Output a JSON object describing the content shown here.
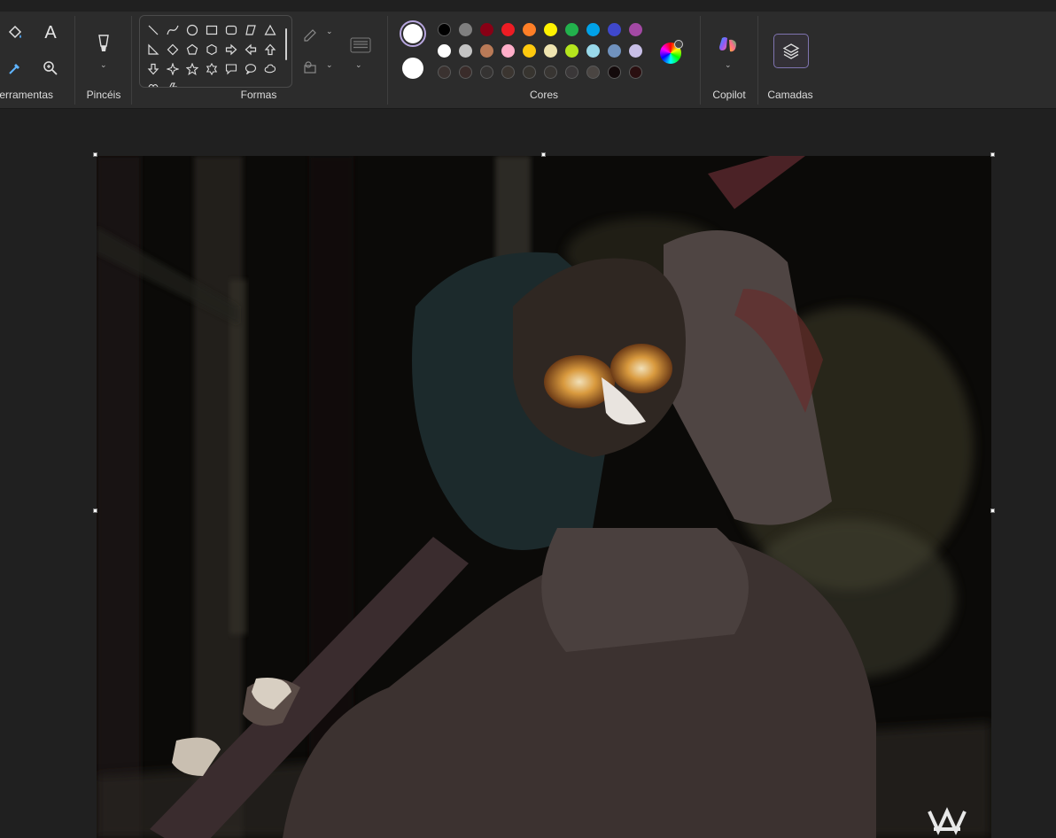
{
  "ribbon": {
    "groups": {
      "tools": "Ferramentas",
      "brushes": "Pincéis",
      "shapes": "Formas",
      "colors": "Cores",
      "copilot": "Copilot",
      "layers": "Camadas"
    },
    "tools_glyphs": {
      "text": "A"
    }
  },
  "colors": {
    "primary": "#ffffff",
    "secondary": "#ffffff",
    "palette_row1": [
      "#000000",
      "#7f7f7f",
      "#880015",
      "#ed1c24",
      "#ff7f27",
      "#fff200",
      "#22b14c",
      "#00a2e8",
      "#3f48cc",
      "#a349a4"
    ],
    "palette_row2": [
      "#ffffff",
      "#c3c3c3",
      "#b97a57",
      "#ffaec9",
      "#ffc90e",
      "#efe4b0",
      "#b5e61d",
      "#99d9ea",
      "#7092be",
      "#c8bfe7"
    ],
    "palette_row3": [
      "#3a3230",
      "#3a2c2a",
      "#353332",
      "#3b3530",
      "#37342f",
      "#383532",
      "#3a3738",
      "#4a4542",
      "#130a0b",
      "#2a0f10"
    ]
  }
}
